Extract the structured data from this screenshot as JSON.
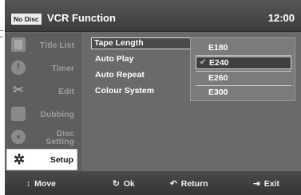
{
  "header": {
    "disc_badge": "No Disc",
    "title": "VCR Function",
    "clock": "12:00"
  },
  "sidebar": {
    "items": [
      {
        "label": "Title List",
        "icon": "title-list-icon",
        "active": false
      },
      {
        "label": "Timer",
        "icon": "timer-icon",
        "active": false
      },
      {
        "label": "Edit",
        "icon": "scissors-icon",
        "active": false
      },
      {
        "label": "Dubbing",
        "icon": "dubbing-icon",
        "active": false
      },
      {
        "label_line1": "Disc",
        "label_line2": "Setting",
        "icon": "disc-icon",
        "active": false
      },
      {
        "label": "Setup",
        "icon": "gear-icon",
        "active": true
      }
    ]
  },
  "menu": {
    "items": [
      {
        "label": "Tape Length",
        "selected": true
      },
      {
        "label": "Auto Play",
        "selected": false
      },
      {
        "label": "Auto Repeat",
        "selected": false
      },
      {
        "label": "Colour System",
        "selected": false
      }
    ]
  },
  "popup": {
    "options": [
      {
        "label": "E180",
        "checked": false,
        "highlighted": false
      },
      {
        "label": "E240",
        "checked": true,
        "highlighted": true
      },
      {
        "label": "E260",
        "checked": false,
        "highlighted": false
      },
      {
        "label": "E300",
        "checked": false,
        "highlighted": false
      }
    ]
  },
  "footer": {
    "move": {
      "glyph": "↕",
      "label": "Move"
    },
    "ok": {
      "glyph": "↻",
      "label": "Ok"
    },
    "return": {
      "glyph": "↶",
      "label": "Return"
    },
    "exit": {
      "glyph": "⇥",
      "label": "Exit"
    }
  },
  "colors": {
    "background": "#6a6a6a",
    "header": "#4a4a4a",
    "text": "#ffffff",
    "active_tab": "#ffffff"
  }
}
